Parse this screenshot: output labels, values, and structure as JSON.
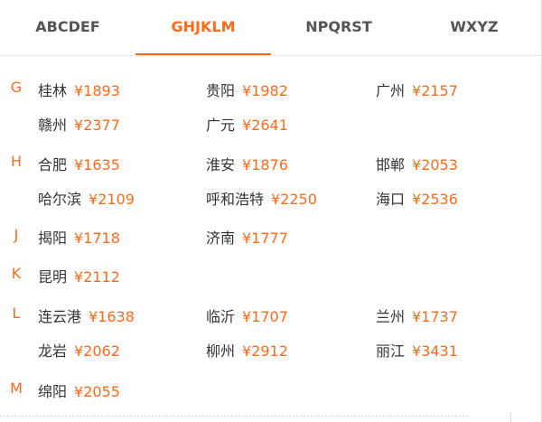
{
  "tabs": [
    {
      "label": "ABCDEF",
      "active": false
    },
    {
      "label": "GHJKLM",
      "active": true
    },
    {
      "label": "NPQRST",
      "active": false
    },
    {
      "label": "WXYZ",
      "active": false
    }
  ],
  "groups": [
    {
      "letter": "G",
      "rows": [
        [
          {
            "city": "桂林",
            "price": "¥1893"
          },
          {
            "city": "贵阳",
            "price": "¥1982"
          },
          {
            "city": "广州",
            "price": "¥2157"
          }
        ],
        [
          {
            "city": "赣州",
            "price": "¥2377"
          },
          {
            "city": "广元",
            "price": "¥2641"
          }
        ]
      ]
    },
    {
      "letter": "H",
      "rows": [
        [
          {
            "city": "合肥",
            "price": "¥1635"
          },
          {
            "city": "淮安",
            "price": "¥1876"
          },
          {
            "city": "邯郸",
            "price": "¥2053"
          }
        ],
        [
          {
            "city": "哈尔滨",
            "price": "¥2109"
          },
          {
            "city": "呼和浩特",
            "price": "¥2250"
          },
          {
            "city": "海口",
            "price": "¥2536"
          }
        ]
      ]
    },
    {
      "letter": "J",
      "rows": [
        [
          {
            "city": "揭阳",
            "price": "¥1718"
          },
          {
            "city": "济南",
            "price": "¥1777"
          }
        ]
      ]
    },
    {
      "letter": "K",
      "rows": [
        [
          {
            "city": "昆明",
            "price": "¥2112"
          }
        ]
      ]
    },
    {
      "letter": "L",
      "rows": [
        [
          {
            "city": "连云港",
            "price": "¥1638"
          },
          {
            "city": "临沂",
            "price": "¥1707"
          },
          {
            "city": "兰州",
            "price": "¥1737"
          }
        ],
        [
          {
            "city": "龙岩",
            "price": "¥2062"
          },
          {
            "city": "柳州",
            "price": "¥2912"
          },
          {
            "city": "丽江",
            "price": "¥3431"
          }
        ]
      ]
    },
    {
      "letter": "M",
      "rows": [
        [
          {
            "city": "绵阳",
            "price": "¥2055"
          }
        ]
      ]
    }
  ]
}
